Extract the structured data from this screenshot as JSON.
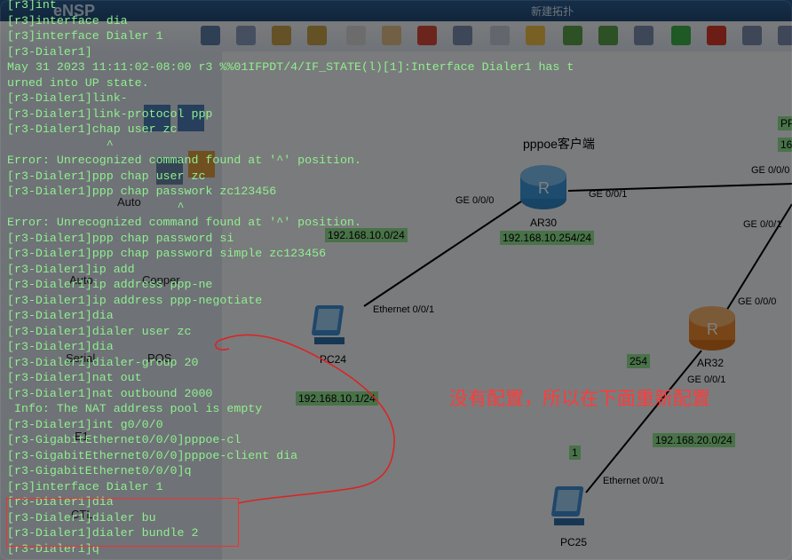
{
  "window": {
    "app_logo": "eNSP",
    "title": "新建拓扑"
  },
  "sidebar": {
    "items": [
      {
        "label": "Auto"
      },
      {
        "label": "Auto"
      },
      {
        "label": "Copper"
      },
      {
        "label": "Serial"
      },
      {
        "label": "POS"
      },
      {
        "label": "E1"
      },
      {
        "label": "CTL"
      }
    ]
  },
  "topology": {
    "section_label": "pppoe客户端",
    "devices": [
      {
        "name": "AR30"
      },
      {
        "name": "AR32"
      },
      {
        "name": "PC24"
      },
      {
        "name": "PC25"
      }
    ],
    "ports": [
      "GE 0/0/0",
      "GE 0/0/1",
      "GE 0/0/0",
      "GE 0/0/1",
      "GE 0/0/0",
      "GE 0/0/1",
      "Ethernet 0/0/1",
      "Ethernet 0/0/1"
    ],
    "ip_labels": [
      "192.168.10.0/24",
      "192.168.10.254/24",
      "192.168.10.1/24",
      "254",
      "192.168.20.0/24",
      "1",
      "PP",
      "16"
    ]
  },
  "annotation": "没有配置，所以在下面重新配置",
  "terminal": {
    "lines": [
      "[r3]int",
      "[r3]interface dia",
      "[r3]interface Dialer 1",
      "[r3-Dialer1]",
      "May 31 2023 11:11:02-08:00 r3 %%01IFPDT/4/IF_STATE(l)[1]:Interface Dialer1 has t",
      "urned into UP state.",
      "[r3-Dialer1]link-",
      "[r3-Dialer1]link-protocol ppp",
      "[r3-Dialer1]chap user zc",
      "              ^",
      "Error: Unrecognized command found at '^' position.",
      "[r3-Dialer1]ppp chap user zc",
      "[r3-Dialer1]ppp chap passwork zc123456",
      "                        ^",
      "Error: Unrecognized command found at '^' position.",
      "[r3-Dialer1]ppp chap password si",
      "[r3-Dialer1]ppp chap password simple zc123456",
      "[r3-Dialer1]ip add",
      "[r3-Dialer1]ip address ppp-ne",
      "[r3-Dialer1]ip address ppp-negotiate",
      "[r3-Dialer1]dia",
      "[r3-Dialer1]dialer user zc",
      "[r3-Dialer1]dia",
      "[r3-Dialer1]dialer-group 20",
      "[r3-Dialer1]nat out",
      "[r3-Dialer1]nat outbound 2000",
      " Info: The NAT address pool is empty",
      "[r3-Dialer1]int g0/0/0",
      "[r3-GigabitEthernet0/0/0]pppoe-cl",
      "[r3-GigabitEthernet0/0/0]pppoe-client dia",
      "[r3-GigabitEthernet0/0/0]q",
      "[r3]interface Dialer 1",
      "[r3-Dialer1]dia",
      "[r3-Dialer1]dialer bu",
      "[r3-Dialer1]dialer bundle 2",
      "[r3-Dialer1]q"
    ]
  }
}
